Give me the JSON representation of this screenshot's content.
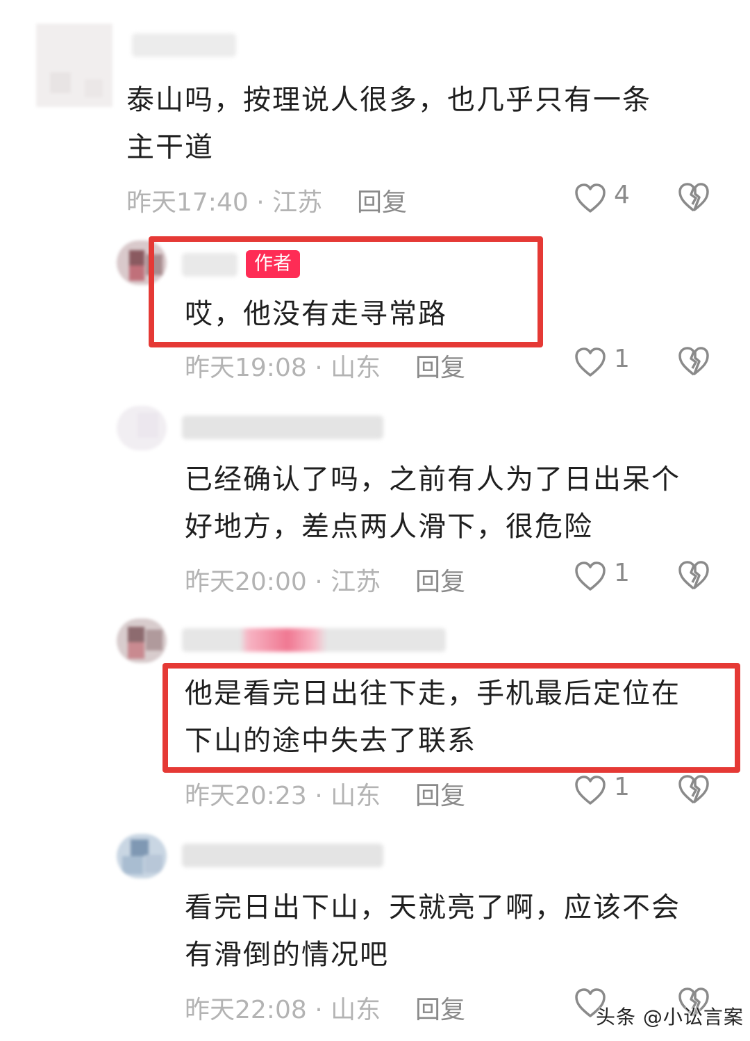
{
  "comments": [
    {
      "text": "泰山吗，按理说人很多，也几乎只有一条\n主干道",
      "meta": "昨天17:40 · 江苏",
      "reply": "回复",
      "likes": "4"
    },
    {
      "badge": "作者",
      "text": "哎，他没有走寻常路",
      "meta": "昨天19:08 · 山东",
      "reply": "回复",
      "likes": "1"
    },
    {
      "text": "已经确认了吗，之前有人为了日出呆个\n好地方，差点两人滑下，很危险",
      "meta": "昨天20:00 · 江苏",
      "reply": "回复",
      "likes": "1"
    },
    {
      "text": "他是看完日出往下走，手机最后定位在\n下山的途中失去了联系",
      "meta": "昨天20:23 · 山东",
      "reply": "回复",
      "likes": "1"
    },
    {
      "text": "看完日出下山，天就亮了啊，应该不会\n有滑倒的情况吧",
      "meta": "昨天22:08 · 山东",
      "reply": "回复",
      "likes": ""
    }
  ],
  "watermark": "头条 @小讼言案",
  "colors": {
    "highlight": "#e53935",
    "badge": "#fe2c55",
    "meta": "#b3b3b3"
  },
  "icons": [
    "heart-outline-icon",
    "broken-heart-icon"
  ]
}
